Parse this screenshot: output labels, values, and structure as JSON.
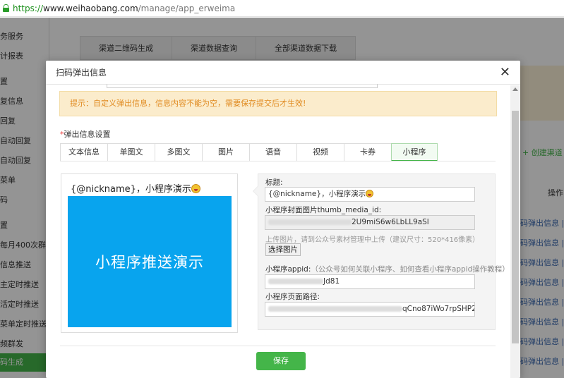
{
  "browser": {
    "scheme": "https://",
    "host": "www.weihaobang.com",
    "path": "/manage/app_erweima"
  },
  "background": {
    "sidebar": [
      "务服务",
      "计报表",
      "置",
      "复信息",
      "回复",
      "自动回复",
      "自动回复",
      "菜单",
      "码",
      "置",
      "每月400次群发",
      "信息推送",
      "主定时推送",
      "活定时推送",
      "菜单定时推送",
      "频群发",
      "码生成"
    ],
    "tabs": [
      "渠道二维码生成",
      "渠道数据查询",
      "全部渠道数据下载"
    ],
    "create_label": "+ 创建渠道",
    "op_header": "操作",
    "cells": [
      "码弹出信息 |",
      "码弹出信息 |",
      "码弹出信息 |",
      "码弹出信息 |",
      "码弹出信息 |",
      "码弹出信息 |",
      "码弹出信息 |",
      "码弹出信息 |"
    ]
  },
  "modal": {
    "title": "扫码弹出信息",
    "tip": "提示：自定义弹出信息，信息内容不能为空，需要保存提交后才生效!",
    "section_required": "*",
    "section_label": "弹出信息设置",
    "tabs": [
      "文本信息",
      "单图文",
      "多图文",
      "图片",
      "语音",
      "视频",
      "卡券",
      "小程序"
    ],
    "preview": {
      "title": "{@nickname}，小程序演示",
      "image_text": "小程序推送演示"
    },
    "form": {
      "title_label": "标题:",
      "title_value": "{@nickname}，小程序演示",
      "thumb_label": "小程序封面图片thumb_media_id:",
      "thumb_value": "2U9miS6w6LbLL9aSl",
      "upload_help": "上传图片，请到公众号素材管理中上传（建议尺寸：520*416像素）",
      "pick_button": "选择图片",
      "appid_label": "小程序appid:",
      "appid_hint": "（公众号如何关联小程序、如何查看小程序appid操作教程）",
      "appid_value": "Jd81",
      "path_label": "小程序页面路径:",
      "path_value": "qCno87iWo7rpSHP2"
    },
    "save_button": "保存"
  },
  "colors": {
    "accent": "#44b549",
    "tip_bg": "#fbeccc",
    "tip_text": "#e08a1f",
    "preview_blue": "#08a4ee"
  }
}
